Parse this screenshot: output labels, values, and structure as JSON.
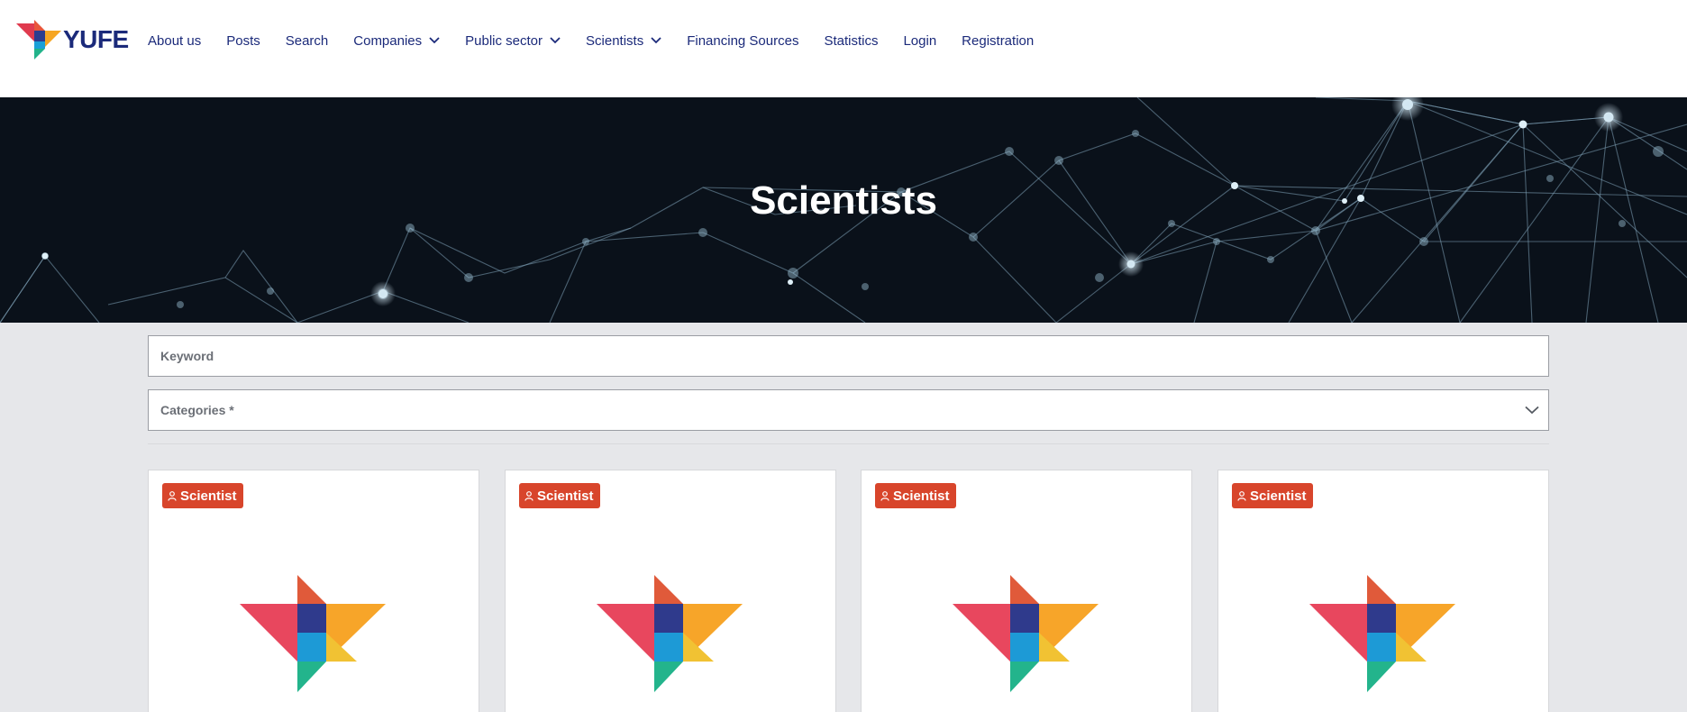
{
  "header": {
    "logo_text": "YUFE",
    "nav": [
      {
        "label": "About us",
        "has_dropdown": false
      },
      {
        "label": "Posts",
        "has_dropdown": false
      },
      {
        "label": "Search",
        "has_dropdown": false
      },
      {
        "label": "Companies",
        "has_dropdown": true
      },
      {
        "label": "Public sector",
        "has_dropdown": true
      },
      {
        "label": "Scientists",
        "has_dropdown": true
      },
      {
        "label": "Financing Sources",
        "has_dropdown": false
      },
      {
        "label": "Statistics",
        "has_dropdown": false
      },
      {
        "label": "Login",
        "has_dropdown": false
      },
      {
        "label": "Registration",
        "has_dropdown": false
      }
    ]
  },
  "hero": {
    "title": "Scientists"
  },
  "filters": {
    "keyword_label": "Keyword",
    "categories_label": "Categories *"
  },
  "cards": [
    {
      "badge": "Scientist",
      "icon": "user-icon"
    },
    {
      "badge": "Scientist",
      "icon": "user-icon"
    },
    {
      "badge": "Scientist",
      "icon": "user-icon"
    },
    {
      "badge": "Scientist",
      "icon": "user-icon"
    }
  ],
  "colors": {
    "brand_navy": "#1b2a7a",
    "badge_red": "#d8452b",
    "page_bg": "#e6e7ea",
    "hero_bg": "#0a111a"
  }
}
